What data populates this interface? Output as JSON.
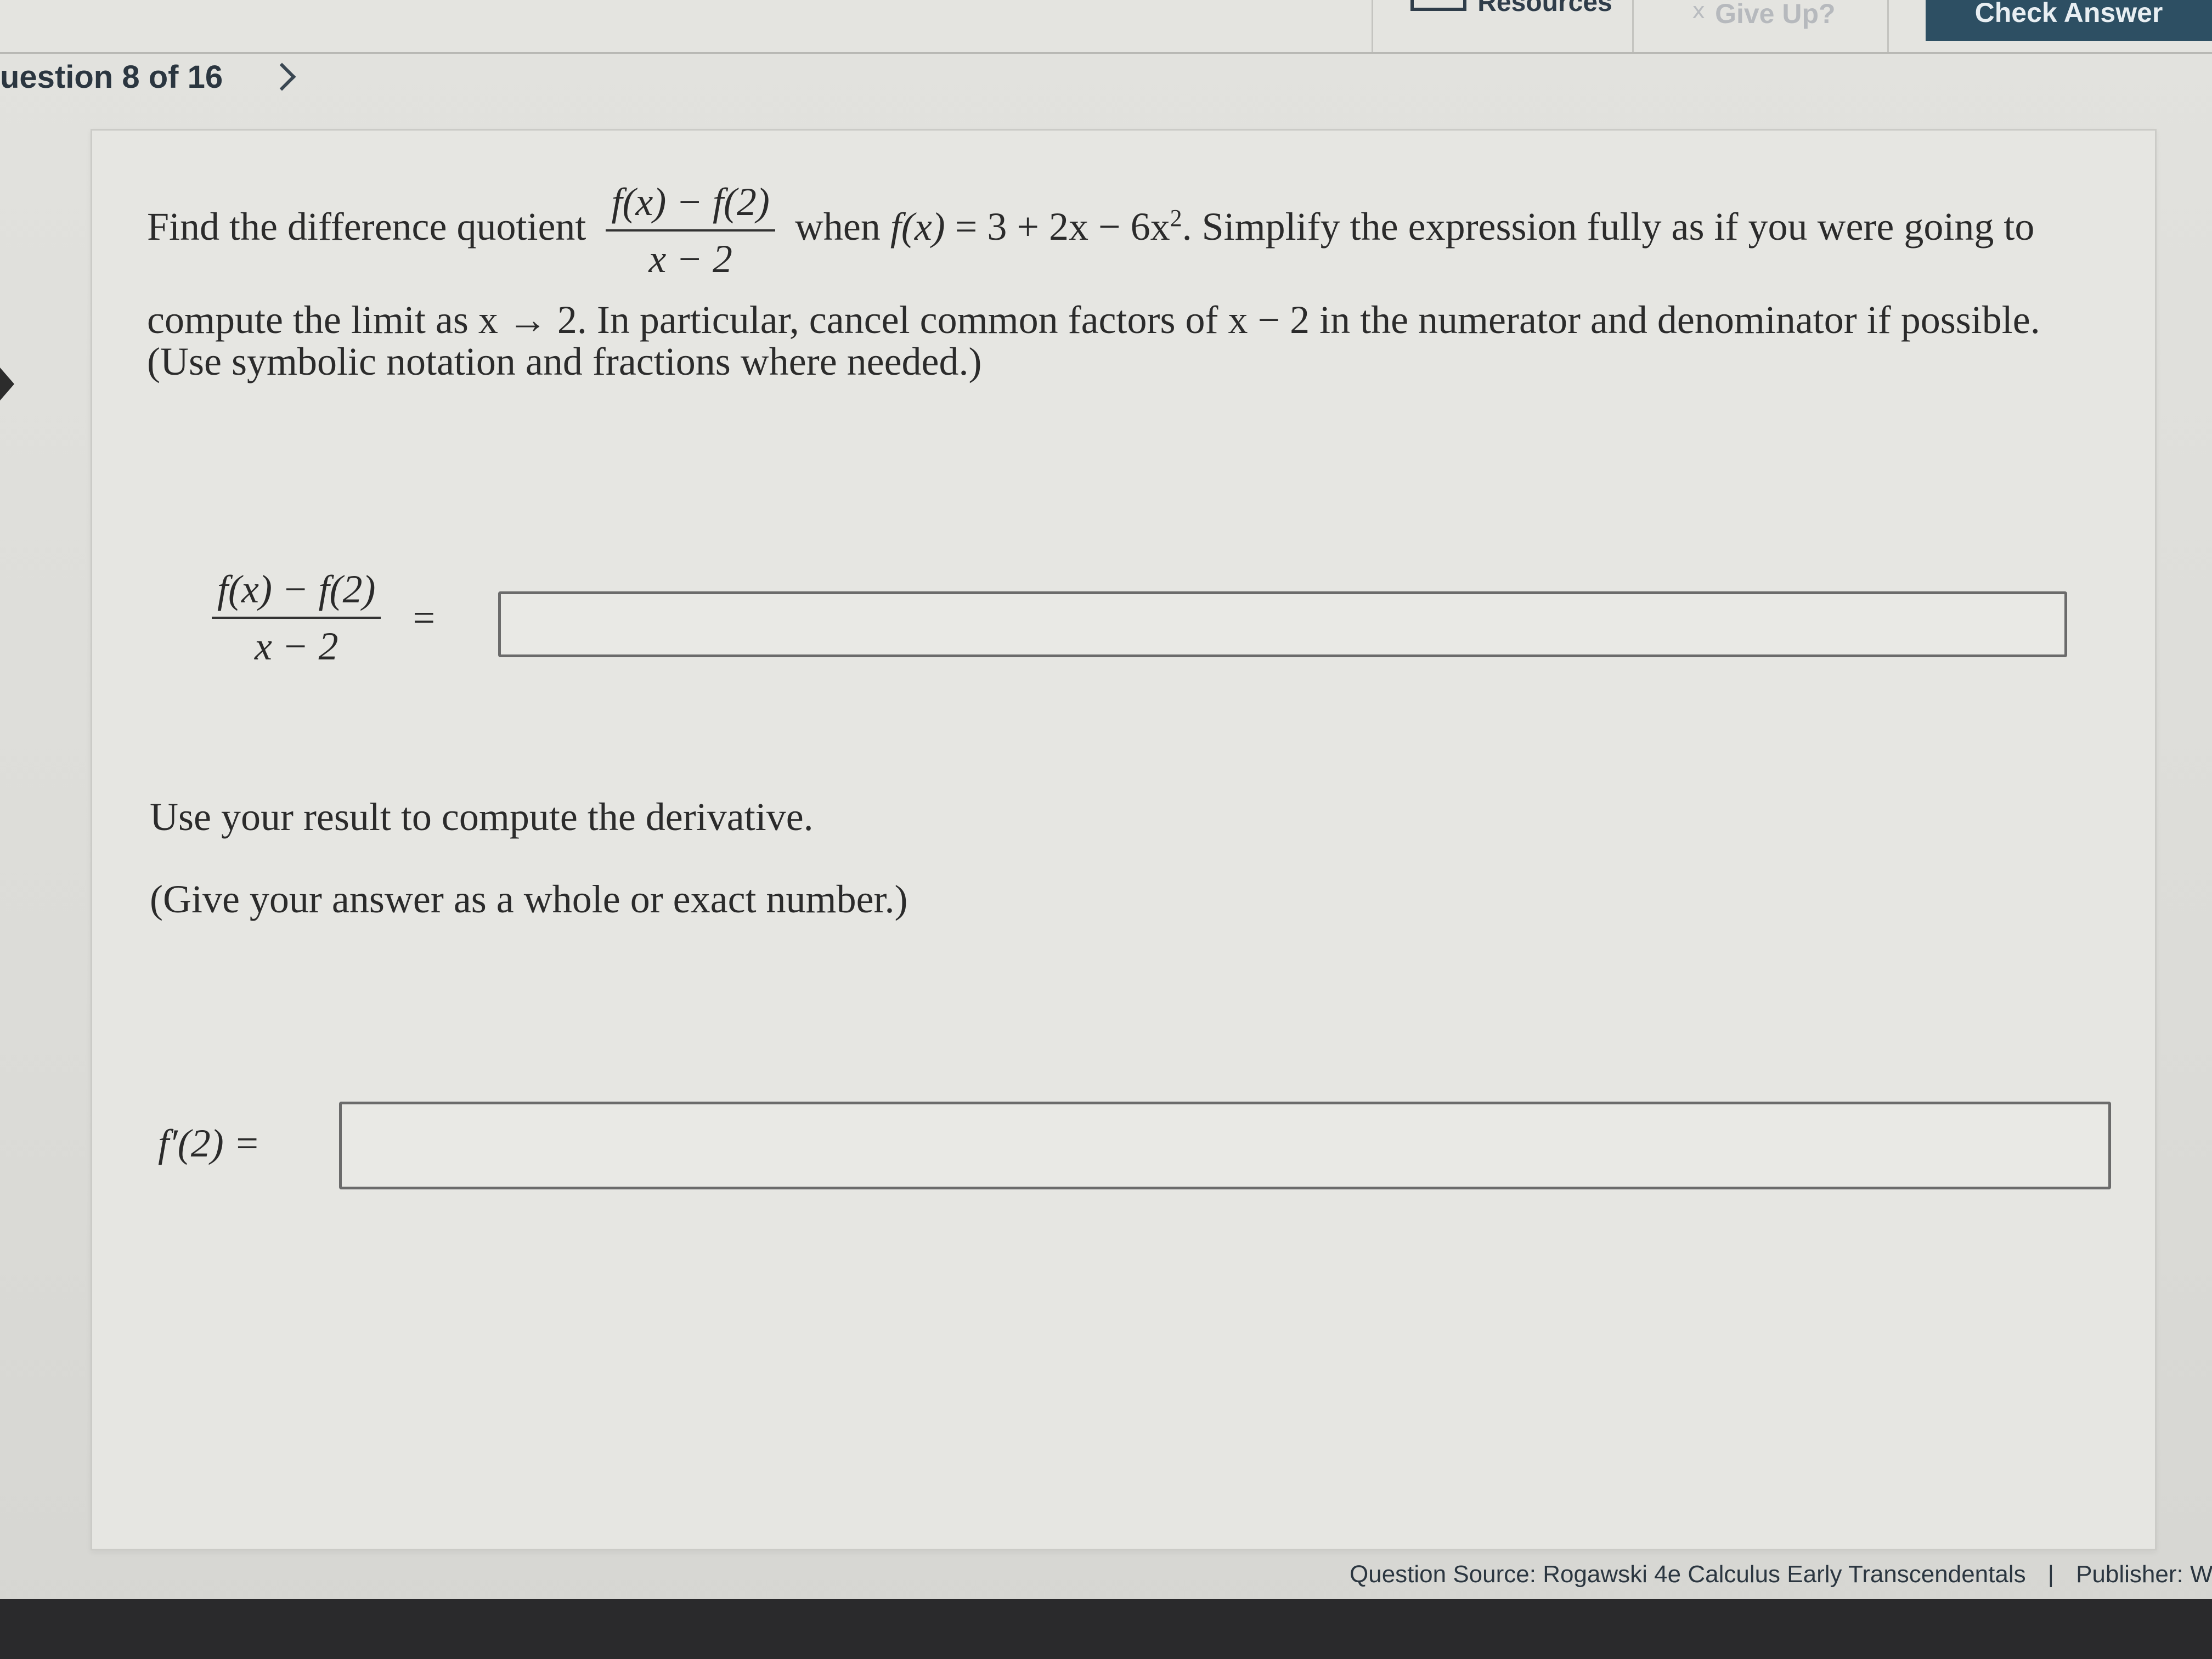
{
  "topbar": {
    "resources_label": "Resources",
    "giveup_label": "Give Up?",
    "giveup_icon": "x",
    "check_label": "Check Answer"
  },
  "nav": {
    "question_label": "uestion 8 of 16",
    "next_chevron": ">"
  },
  "question": {
    "prompt_lead": "Find the difference quotient",
    "frac_num": "f(x) − f(2)",
    "frac_den": "x − 2",
    "prompt_when": "when",
    "fx": "f(x)",
    "prompt_func_rhs": " = 3 + 2x − 6x",
    "exponent": "2",
    "prompt_rest1": ". Simplify the expression fully as if you were going to",
    "prompt_line2": "compute the limit as x → 2. In particular, cancel common factors of x − 2 in the numerator and denominator if possible.",
    "prompt_line3": "(Use symbolic notation and fractions where needed.)"
  },
  "answer1": {
    "num": "f(x) − f(2)",
    "den": "x − 2",
    "eq": "=",
    "value": ""
  },
  "part2": {
    "text1": "Use your result to compute the derivative.",
    "text2": "(Give your answer as a whole or exact number.)",
    "label": "f′(2) =",
    "value": ""
  },
  "footer": {
    "source": "Question Source: Rogawski 4e Calculus Early Transcendentals",
    "divider": "|",
    "publisher": "Publisher: W.H. F"
  },
  "colors": {
    "check_button_bg": "#2d4f63",
    "background": "#dcdcd8"
  }
}
